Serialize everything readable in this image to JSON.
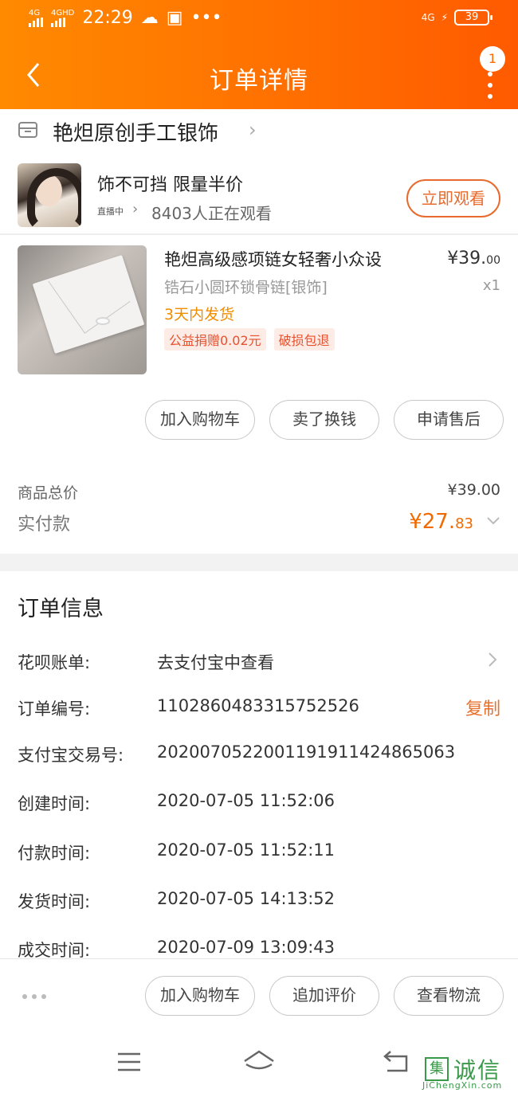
{
  "status_bar": {
    "net1": "4G",
    "net2": "4GHD",
    "time": "22:29",
    "net_right": "4G",
    "battery": "39"
  },
  "nav": {
    "title": "订单详情",
    "badge": "1"
  },
  "shop": {
    "name": "艳炟原创手工银饰"
  },
  "live": {
    "title": "饰不可挡 限量半价",
    "tag": "直播中",
    "watchers": "8403人正在观看",
    "button": "立即观看"
  },
  "product": {
    "title": "艳炟高级感项链女轻奢小众设",
    "sku": "锆石小圆环锁骨链[银饰]",
    "ship": "3天内发货",
    "tags": [
      "公益捐赠0.02元",
      "破损包退"
    ],
    "price_int": "¥39.",
    "price_dec": "00",
    "qty": "x1"
  },
  "actions_top": [
    "加入购物车",
    "卖了换钱",
    "申请售后"
  ],
  "totals": {
    "goods_label": "商品总价",
    "goods_value": "¥39.00",
    "paid_label": "实付款",
    "paid_int": "¥27.",
    "paid_dec": "83"
  },
  "order_info": {
    "title": "订单信息",
    "rows": [
      {
        "key": "花呗账单:",
        "value": "去支付宝中查看"
      },
      {
        "key": "订单编号:",
        "value": "1102860483315752526",
        "action": "复制"
      },
      {
        "key": "支付宝交易号:",
        "value": "2020070522001191911424865063"
      },
      {
        "key": "创建时间:",
        "value": "2020-07-05 11:52:06"
      },
      {
        "key": "付款时间:",
        "value": "2020-07-05 11:52:11"
      },
      {
        "key": "发货时间:",
        "value": "2020-07-05 14:13:52"
      },
      {
        "key": "成交时间:",
        "value": "2020-07-09 13:09:43"
      }
    ]
  },
  "actions_bottom": [
    "加入购物车",
    "追加评价",
    "查看物流"
  ],
  "watermark": {
    "icon": "集",
    "text": "诚信",
    "sub": "JiChengXin.com"
  },
  "colors": {
    "brand": "#ff6a00",
    "price": "#f06a00",
    "accent": "#e86a2c"
  }
}
